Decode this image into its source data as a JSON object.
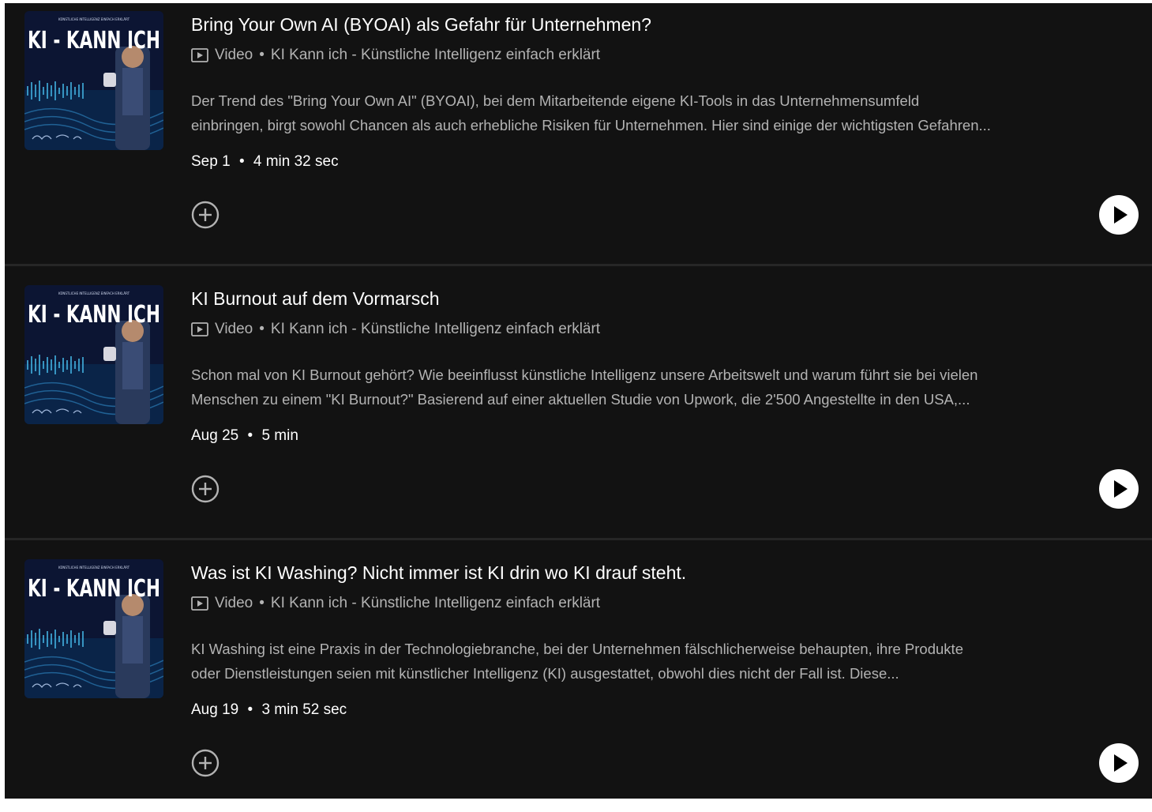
{
  "episodes": [
    {
      "title": "Bring Your Own AI (BYOAI) als Gefahr für Unternehmen?",
      "type": "Video",
      "show": "KI Kann ich - Künstliche Intelligenz einfach erklärt",
      "desc_line1": "Der Trend des \"Bring Your Own AI\" (BYOAI), bei dem Mitarbeitende eigene KI-Tools in das Unternehmensumfeld",
      "desc_line2": "einbringen, birgt sowohl Chancen als auch erhebliche Risiken für Unternehmen. Hier sind einige der wichtigsten Gefahren...",
      "date": "Sep 1",
      "duration": "4 min 32 sec"
    },
    {
      "title": "KI Burnout auf dem Vormarsch",
      "type": "Video",
      "show": "KI Kann ich - Künstliche Intelligenz einfach erklärt",
      "desc_line1": "Schon mal von KI Burnout gehört? Wie beeinflusst künstliche Intelligenz unsere Arbeitswelt und warum führt sie bei vielen",
      "desc_line2": "Menschen zu einem \"KI Burnout?\" Basierend auf einer aktuellen Studie von Upwork, die 2'500 Angestellte in den USA,...",
      "date": "Aug 25",
      "duration": "5 min"
    },
    {
      "title": "Was ist KI Washing? Nicht immer ist KI drin wo KI drauf steht.",
      "type": "Video",
      "show": "KI Kann ich - Künstliche Intelligenz einfach erklärt",
      "desc_line1": "KI Washing ist eine Praxis in der Technologiebranche, bei der Unternehmen fälschlicherweise behaupten, ihre Produkte",
      "desc_line2": "oder Dienstleistungen seien mit künstlicher Intelligenz (KI) ausgestattet, obwohl dies nicht der Fall ist. Diese...",
      "date": "Aug 19",
      "duration": "3 min 52 sec"
    }
  ],
  "cover": {
    "headline": "KI - KANN ICH",
    "tagline": "KÜNSTLICHE INTELLIGENZ EINFACH ERKLÄRT"
  },
  "separator": "•",
  "colors": {
    "background": "#121212",
    "divider": "#262626",
    "primary_text": "#ffffff",
    "secondary_text": "#b3b3b3",
    "play_button": "#ffffff"
  },
  "icons": {
    "type": "video-play-box-icon",
    "add": "plus-circle-icon",
    "play": "play-circle-icon"
  }
}
